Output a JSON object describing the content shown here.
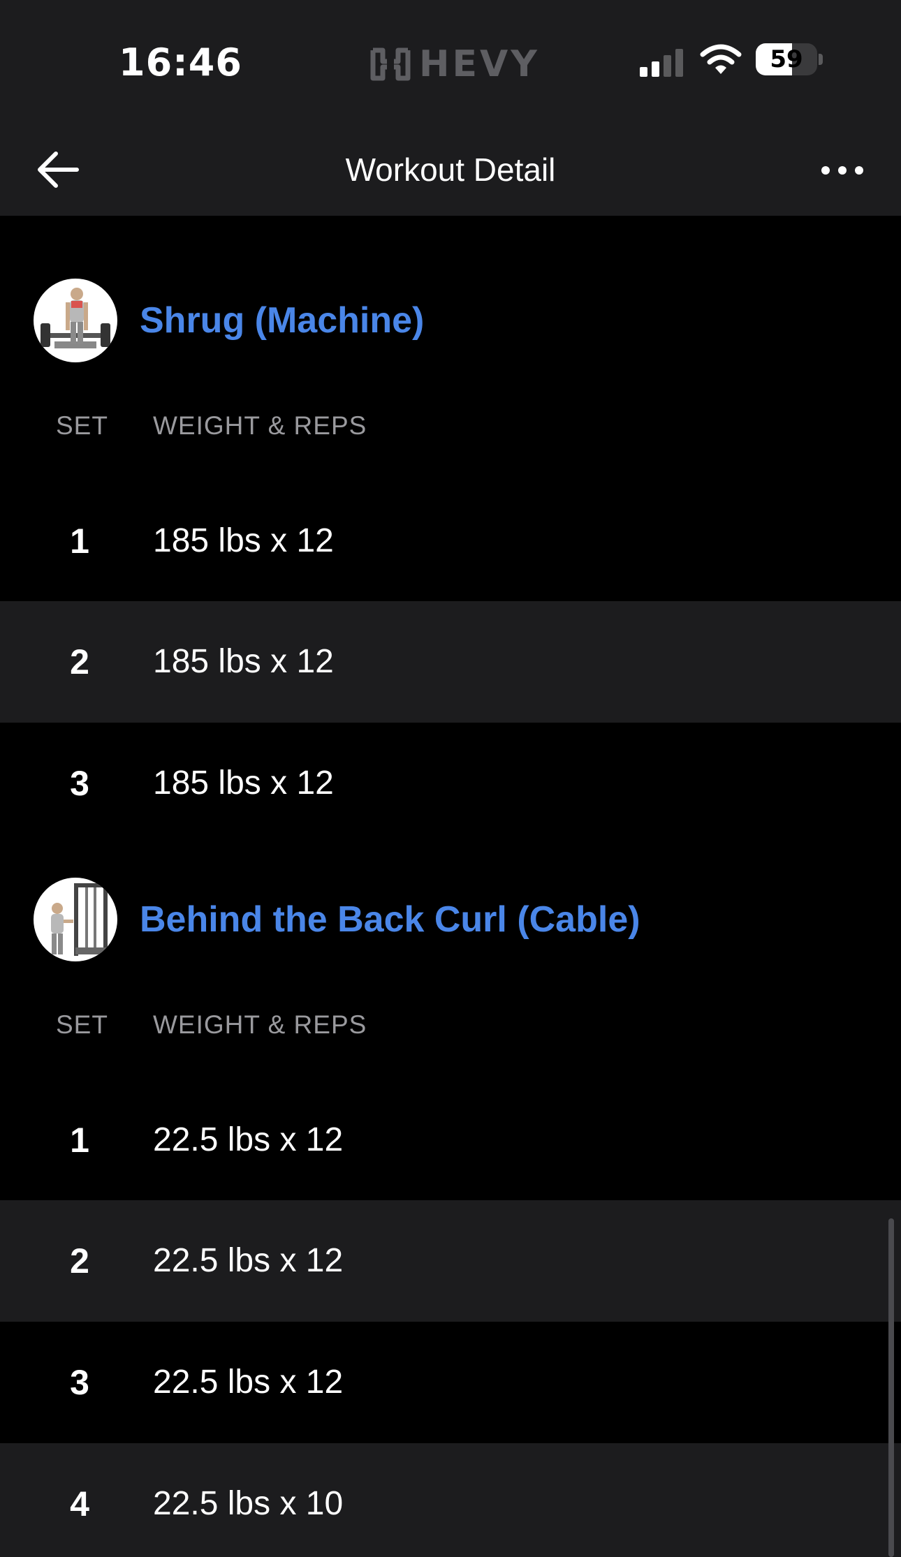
{
  "status_bar": {
    "time": "16:46",
    "brand": "HEVY",
    "battery_level": "59",
    "battery_fraction": 0.59,
    "signal_bars_active": 2,
    "signal_bars_total": 4,
    "icons": [
      "hevy-logo-icon",
      "cellular-signal-icon",
      "wifi-icon",
      "battery-icon"
    ]
  },
  "nav": {
    "title": "Workout Detail",
    "back_icon": "arrow-left-icon",
    "more_icon": "ellipsis-icon"
  },
  "colors": {
    "accent": "#4a86e8",
    "background": "#000000",
    "surface": "#1c1c1e",
    "muted_text": "#9a9a9e"
  },
  "exercises": [
    {
      "name": "Shrug (Machine)",
      "thumbnail_icon": "shrug-machine-illustration",
      "col_set": "SET",
      "col_weight_reps": "WEIGHT & REPS",
      "sets": [
        {
          "set": "1",
          "weight_reps": "185 lbs x 12"
        },
        {
          "set": "2",
          "weight_reps": "185 lbs x 12"
        },
        {
          "set": "3",
          "weight_reps": "185 lbs x 12"
        }
      ]
    },
    {
      "name": "Behind the Back Curl (Cable)",
      "thumbnail_icon": "cable-curl-illustration",
      "col_set": "SET",
      "col_weight_reps": "WEIGHT & REPS",
      "sets": [
        {
          "set": "1",
          "weight_reps": "22.5 lbs x 12"
        },
        {
          "set": "2",
          "weight_reps": "22.5 lbs x 12"
        },
        {
          "set": "3",
          "weight_reps": "22.5 lbs x 12"
        },
        {
          "set": "4",
          "weight_reps": "22.5 lbs x 10"
        }
      ]
    }
  ]
}
